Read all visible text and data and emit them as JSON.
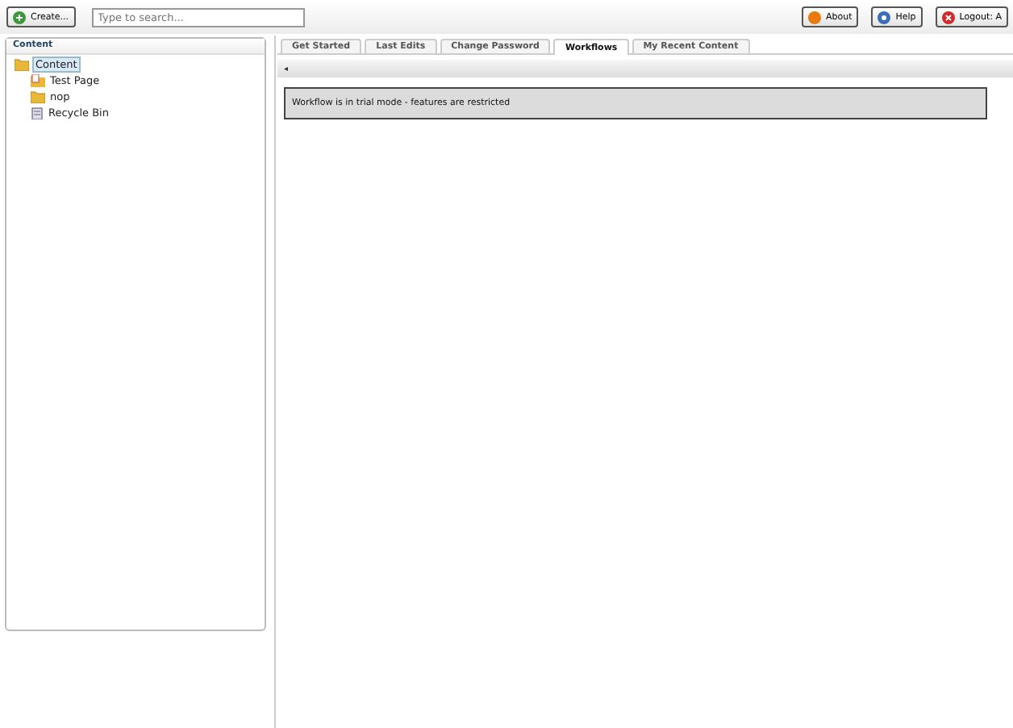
{
  "toolbar": {
    "create_button": "Create...",
    "search": {
      "placeholder": "Type to search..."
    },
    "buttons": [
      {
        "kind": "about",
        "label": "About"
      },
      {
        "kind": "help",
        "label": "Help"
      },
      {
        "kind": "logout",
        "label": "Logout: A"
      }
    ]
  },
  "sidebar": {
    "title": "Content",
    "tree": [
      {
        "label": "Content",
        "kind": "folder",
        "selected": true,
        "children": [
          {
            "label": "Test Page",
            "kind": "page",
            "selected": false
          },
          {
            "label": "nop",
            "kind": "folder",
            "selected": false
          },
          {
            "label": "Recycle Bin",
            "kind": "bin",
            "selected": false
          }
        ]
      }
    ]
  },
  "tabs": [
    {
      "label": "Get Started",
      "selected": false
    },
    {
      "label": "Last Edits",
      "selected": false
    },
    {
      "label": "Change Password",
      "selected": false
    },
    {
      "label": "Workflows",
      "selected": true
    },
    {
      "label": "My Recent Content",
      "selected": false
    }
  ],
  "toolbar_strip": {
    "arrow": "◂"
  },
  "message": "Workflow is in trial mode - features are restricted"
}
